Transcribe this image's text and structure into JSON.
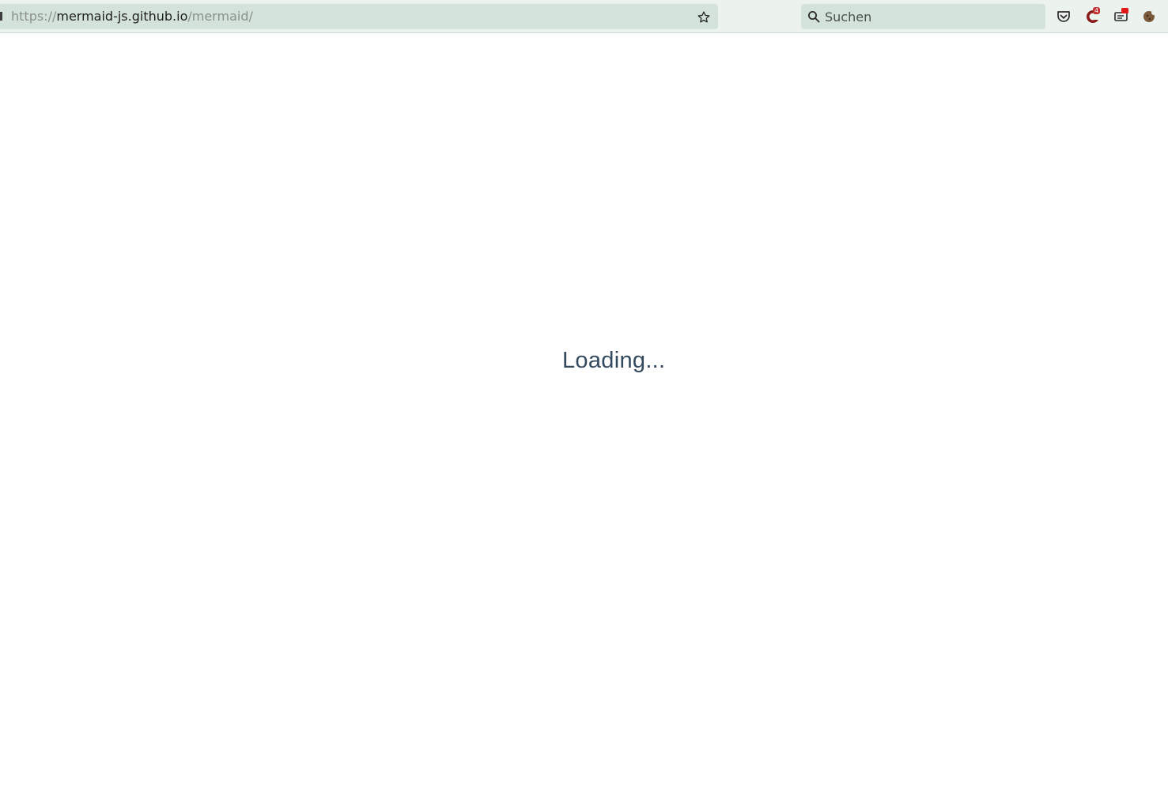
{
  "browser": {
    "url": {
      "scheme": "https://",
      "host": "mermaid-js.github.io",
      "path": "/mermaid/"
    },
    "search": {
      "placeholder": "Suchen"
    },
    "extensions": {
      "badge_count": "4"
    }
  },
  "page": {
    "loading_text": "Loading..."
  },
  "colors": {
    "toolbar_bg": "#ecf2ed",
    "field_bg": "#d4e3da",
    "loading_text": "#34495e"
  }
}
